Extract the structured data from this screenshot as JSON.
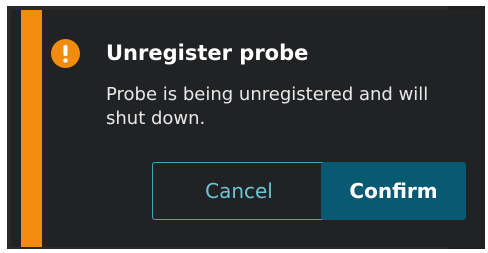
{
  "dialog": {
    "title": "Unregister probe",
    "message": "Probe is being unregistered and will shut down.",
    "icon": "exclamation-icon",
    "accent_color": "#f28c0f",
    "cancel_label": "Cancel",
    "confirm_label": "Confirm"
  }
}
